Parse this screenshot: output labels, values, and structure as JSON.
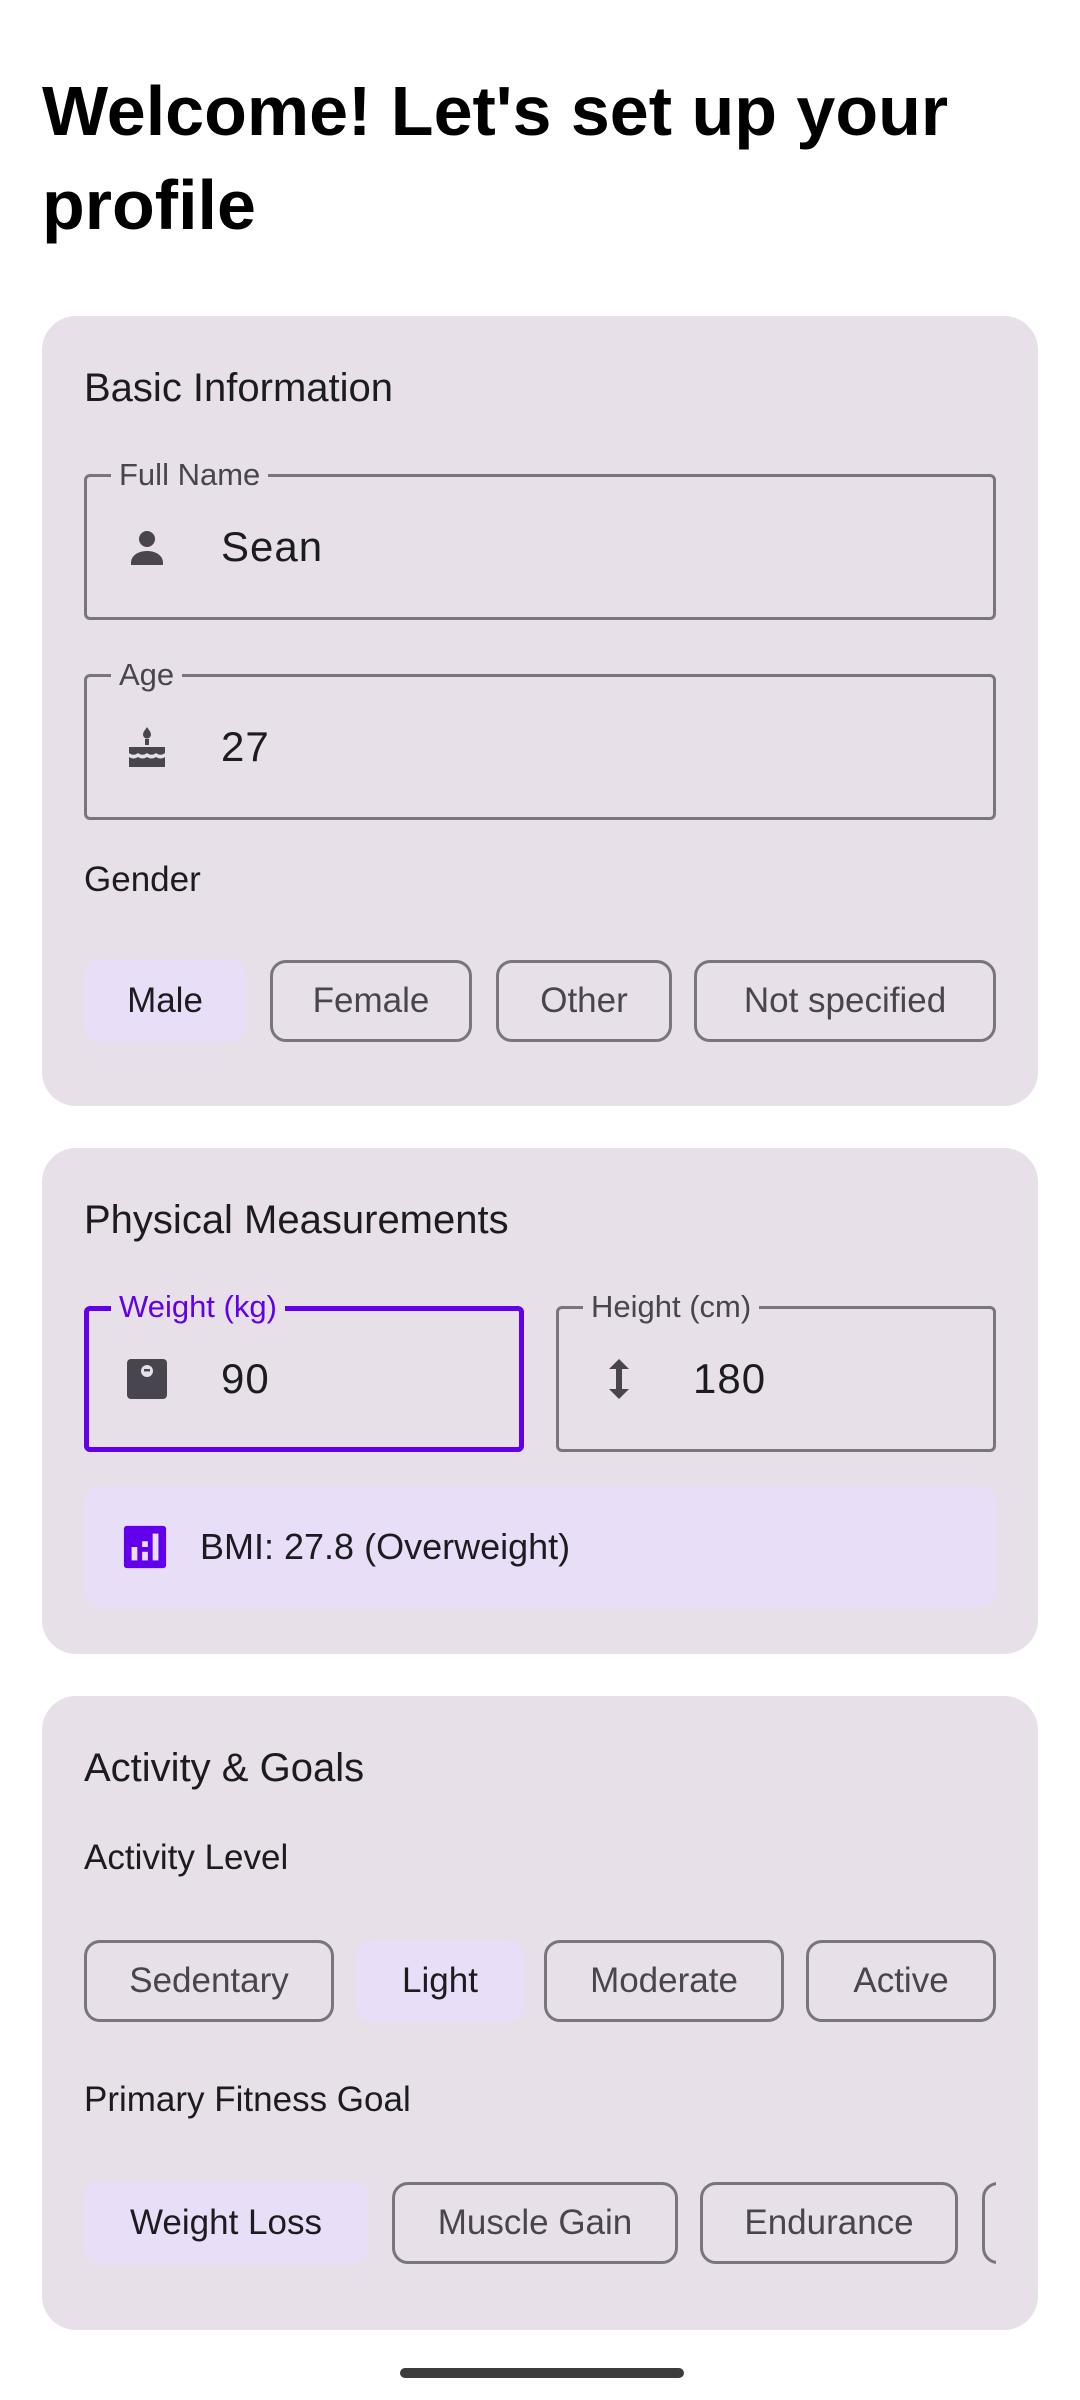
{
  "title": "Welcome! Let's set up your profile",
  "basic": {
    "heading": "Basic Information",
    "full_name": {
      "label": "Full Name",
      "value": "Sean",
      "icon": "person-icon"
    },
    "age": {
      "label": "Age",
      "value": "27",
      "icon": "cake-icon"
    },
    "gender_label": "Gender",
    "gender_options": [
      "Male",
      "Female",
      "Other",
      "Not specified"
    ],
    "gender_selected": "Male"
  },
  "physical": {
    "heading": "Physical Measurements",
    "weight": {
      "label": "Weight (kg)",
      "value": "90",
      "icon": "scale-icon"
    },
    "height": {
      "label": "Height (cm)",
      "value": "180",
      "icon": "height-icon"
    },
    "bmi_text": "BMI: 27.8 (Overweight)"
  },
  "activity": {
    "heading": "Activity & Goals",
    "level_label": "Activity Level",
    "levels": [
      "Sedentary",
      "Light",
      "Moderate",
      "Active"
    ],
    "level_selected": "Light",
    "goal_label": "Primary Fitness Goal",
    "goals": [
      "Weight Loss",
      "Muscle Gain",
      "Endurance"
    ],
    "goal_selected": "Weight Loss"
  },
  "colors": {
    "accent": "#6200ee",
    "card_bg": "#e7e0e8",
    "chip_selected_bg": "#e8def8",
    "outline": "#79747e"
  }
}
